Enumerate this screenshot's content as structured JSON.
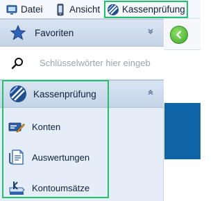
{
  "menubar": {
    "items": [
      {
        "label": "Datei",
        "icon": "file-monitor-icon"
      },
      {
        "label": "Ansicht",
        "icon": "phone-icon"
      },
      {
        "label": "Kassenprüfung",
        "icon": "kassenpruefung-icon"
      }
    ]
  },
  "nav": {
    "favorites": {
      "label": "Favoriten",
      "icon": "star-icon",
      "chevron": "expand-down"
    },
    "search": {
      "placeholder": "Schlüsselwörter hier eingeb",
      "icon": "search-icon"
    },
    "kassen": {
      "label": "Kassenprüfung",
      "icon": "kassenpruefung-icon",
      "chevron": "collapse-up",
      "items": [
        {
          "label": "Konten",
          "icon": "accounts-edit-icon"
        },
        {
          "label": "Auswertungen",
          "icon": "report-document-icon"
        },
        {
          "label": "Kontoumsätze",
          "icon": "account-transactions-icon"
        }
      ]
    }
  },
  "colors": {
    "highlight": "#1fc26b",
    "nav_bg": "#e5edf8",
    "accent_blue": "#0f64a8",
    "back_green": "#3fa82a"
  },
  "content": {
    "back_icon": "back-arrow-icon"
  }
}
